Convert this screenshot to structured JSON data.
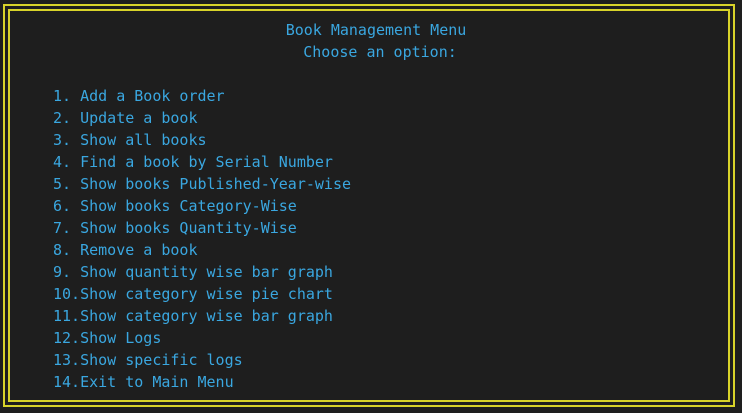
{
  "colors": {
    "background": "#1e1e1e",
    "text": "#3aa7e0",
    "border": "#d8d32a"
  },
  "header": {
    "title": "Book Management Menu",
    "subtitle": "Choose an option:"
  },
  "menu": {
    "items": [
      {
        "label": "1. Add a Book order"
      },
      {
        "label": "2. Update a book"
      },
      {
        "label": "3. Show all books"
      },
      {
        "label": "4. Find a book by Serial Number"
      },
      {
        "label": "5. Show books Published-Year-wise"
      },
      {
        "label": "6. Show books Category-Wise"
      },
      {
        "label": "7. Show books Quantity-Wise"
      },
      {
        "label": "8. Remove a book"
      },
      {
        "label": "9. Show quantity wise bar graph"
      },
      {
        "label": "10.Show category wise pie chart"
      },
      {
        "label": "11.Show category wise bar graph"
      },
      {
        "label": "12.Show Logs"
      },
      {
        "label": "13.Show specific logs"
      },
      {
        "label": "14.Exit to Main Menu"
      }
    ]
  }
}
